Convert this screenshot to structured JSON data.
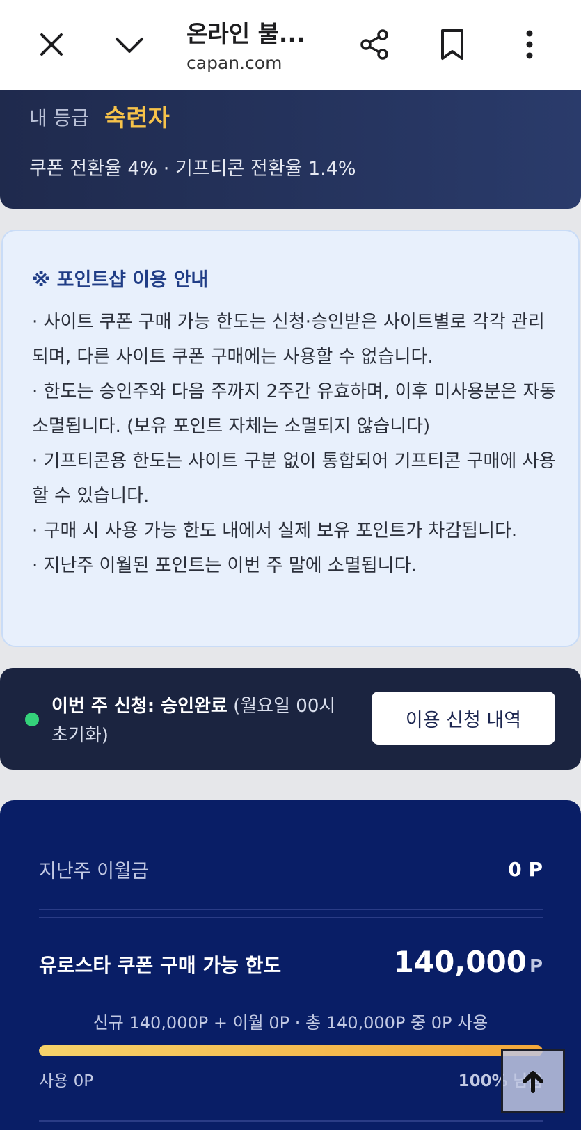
{
  "browser": {
    "title": "온라인 불...",
    "url": "capan.com"
  },
  "grade": {
    "label": "내 등급",
    "value": "숙련자",
    "rates": "쿠폰 전환율 4% · 기프티콘 전환율 1.4%"
  },
  "notice": {
    "title": "※ 포인트샵 이용 안내",
    "items": [
      "· 사이트 쿠폰 구매 가능 한도는 신청·승인받은 사이트별로 각각 관리되며, 다른 사이트 쿠폰 구매에는 사용할 수 없습니다.",
      "· 한도는 승인주와 다음 주까지 2주간 유효하며, 이후 미사용분은 자동 소멸됩니다. (보유 포인트 자체는 소멸되지 않습니다)",
      "· 기프티콘용 한도는 사이트 구분 없이 통합되어 기프티콘 구매에 사용할 수 있습니다.",
      "· 구매 시 사용 가능 한도 내에서 실제 보유 포인트가 차감됩니다.",
      "· 지난주 이월된 포인트는 이번 주 말에 소멸됩니다."
    ]
  },
  "status": {
    "prefix": "이번 주 신청: ",
    "state": "승인완료",
    "note": " (월요일 00시 초기화)",
    "button": "이용 신청 내역"
  },
  "points": {
    "carryover_label": "지난주 이월금",
    "carryover_value": "0 P",
    "limit_label": "유로스타 쿠폰 구매 가능 한도",
    "limit_amount": "140,000",
    "limit_unit": "P",
    "breakdown": "신규 140,000P + 이월 0P · 총 140,000P 중 0P 사용",
    "used_label": "사용 0P",
    "remaining_label": "100% 남음",
    "remaining_fraction": 1.0
  },
  "colors": {
    "grade_accent": "#f7c34a",
    "status_dot": "#34d27a",
    "panel_bg": "#091e66"
  }
}
